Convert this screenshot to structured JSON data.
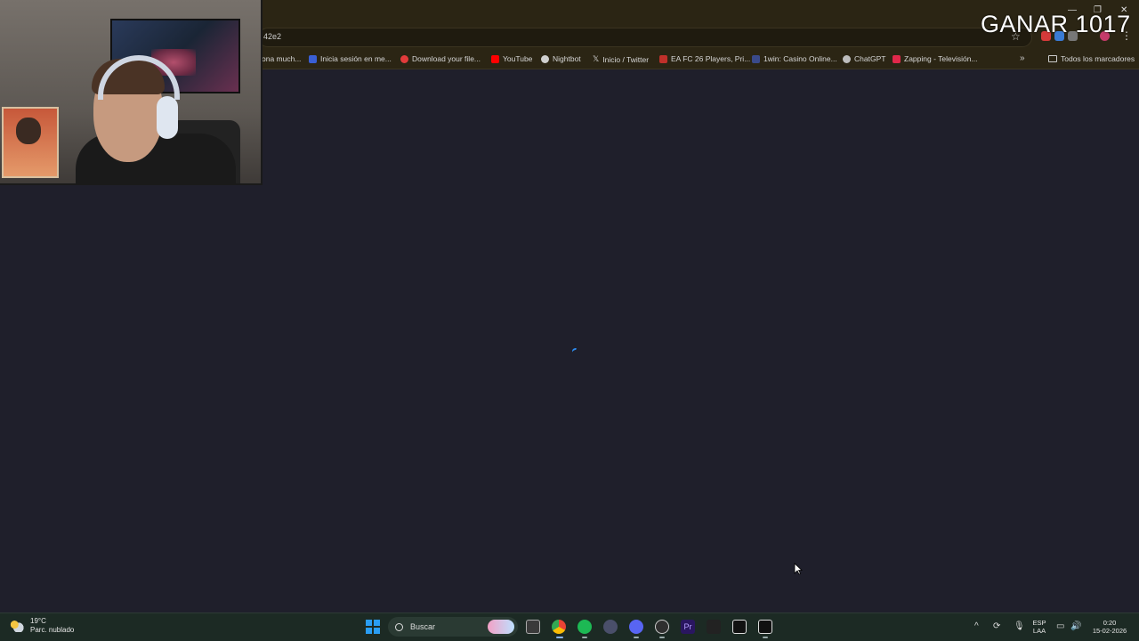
{
  "browser": {
    "url_fragment": "42e2",
    "bookmarks": [
      {
        "label": "ona much...",
        "icon": "bookmark-icon"
      },
      {
        "label": "Inicia sesión en me...",
        "icon": "login-icon"
      },
      {
        "label": "Download your file...",
        "icon": "download-icon"
      },
      {
        "label": "YouTube",
        "icon": "youtube-icon"
      },
      {
        "label": "Nightbot",
        "icon": "nightbot-icon"
      },
      {
        "label": "Inicio / Twitter",
        "icon": "x-icon"
      },
      {
        "label": "EA FC 26 Players, Pri...",
        "icon": "futbin-icon"
      },
      {
        "label": "1win: Casino Online...",
        "icon": "casino-icon"
      },
      {
        "label": "ChatGPT",
        "icon": "chatgpt-icon"
      },
      {
        "label": "Zapping - Televisión...",
        "icon": "zapping-icon"
      }
    ],
    "all_bookmarks_label": "Todos los marcadores",
    "more_bookmarks": "»"
  },
  "overlay": {
    "text": "GANAR 1017"
  },
  "taskbar": {
    "weather_temp": "19°C",
    "weather_desc": "Parc. nublado",
    "search_label": "Buscar",
    "language": "ESP",
    "layout": "LAA",
    "time": "0:20",
    "date": "15-02-2026"
  },
  "colors": {
    "page_bg": "#1f1f2b",
    "chrome_bg": "#2b2514",
    "taskbar_bg": "#1c2a24",
    "spinner": "#2c8bf0"
  }
}
